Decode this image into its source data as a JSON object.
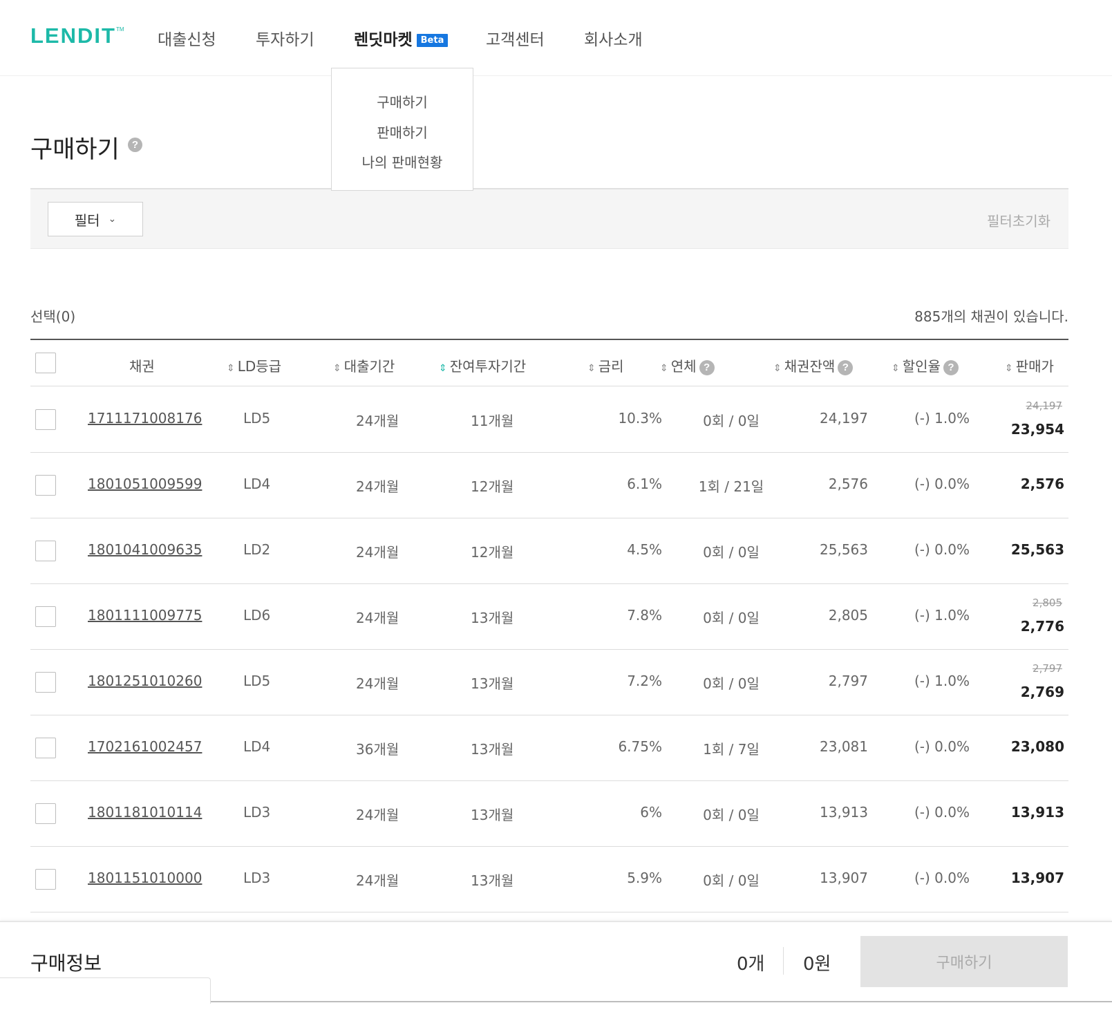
{
  "brand": {
    "logo": "LENDIT",
    "tm": "TM",
    "accent": "#1db9a8"
  },
  "nav": {
    "items": [
      {
        "label": "대출신청"
      },
      {
        "label": "투자하기"
      },
      {
        "label": "렌딧마켓",
        "badge": "Beta"
      },
      {
        "label": "고객센터"
      },
      {
        "label": "회사소개"
      }
    ],
    "dropdown": [
      "구매하기",
      "판매하기",
      "나의 판매현황"
    ]
  },
  "page": {
    "title": "구매하기",
    "help": "?"
  },
  "filter": {
    "button_label": "필터",
    "reset_label": "필터초기화"
  },
  "summary": {
    "selected": "선택(0)",
    "total": "885개의 채권이 있습니다."
  },
  "table": {
    "headers": {
      "bond": "채권",
      "grade": "LD등급",
      "term": "대출기간",
      "remain": "잔여투자기간",
      "rate": "금리",
      "overdue": "연체",
      "balance": "채권잔액",
      "discount": "할인율",
      "price": "판매가"
    },
    "rows": [
      {
        "bond": "1711171008176",
        "grade": "LD5",
        "term": "24개월",
        "remain": "11개월",
        "rate": "10.3%",
        "overdue": "0회 / 0일",
        "balance": "24,197",
        "discount": "(-) 1.0%",
        "orig_price": "24,197",
        "price": "23,954"
      },
      {
        "bond": "1801051009599",
        "grade": "LD4",
        "term": "24개월",
        "remain": "12개월",
        "rate": "6.1%",
        "overdue": "1회 / 21일",
        "balance": "2,576",
        "discount": "(-) 0.0%",
        "orig_price": "",
        "price": "2,576"
      },
      {
        "bond": "1801041009635",
        "grade": "LD2",
        "term": "24개월",
        "remain": "12개월",
        "rate": "4.5%",
        "overdue": "0회 / 0일",
        "balance": "25,563",
        "discount": "(-) 0.0%",
        "orig_price": "",
        "price": "25,563"
      },
      {
        "bond": "1801111009775",
        "grade": "LD6",
        "term": "24개월",
        "remain": "13개월",
        "rate": "7.8%",
        "overdue": "0회 / 0일",
        "balance": "2,805",
        "discount": "(-) 1.0%",
        "orig_price": "2,805",
        "price": "2,776"
      },
      {
        "bond": "1801251010260",
        "grade": "LD5",
        "term": "24개월",
        "remain": "13개월",
        "rate": "7.2%",
        "overdue": "0회 / 0일",
        "balance": "2,797",
        "discount": "(-) 1.0%",
        "orig_price": "2,797",
        "price": "2,769"
      },
      {
        "bond": "1702161002457",
        "grade": "LD4",
        "term": "36개월",
        "remain": "13개월",
        "rate": "6.75%",
        "overdue": "1회 / 7일",
        "balance": "23,081",
        "discount": "(-) 0.0%",
        "orig_price": "",
        "price": "23,080"
      },
      {
        "bond": "1801181010114",
        "grade": "LD3",
        "term": "24개월",
        "remain": "13개월",
        "rate": "6%",
        "overdue": "0회 / 0일",
        "balance": "13,913",
        "discount": "(-) 0.0%",
        "orig_price": "",
        "price": "13,913"
      },
      {
        "bond": "1801151010000",
        "grade": "LD3",
        "term": "24개월",
        "remain": "13개월",
        "rate": "5.9%",
        "overdue": "0회 / 0일",
        "balance": "13,907",
        "discount": "(-) 0.0%",
        "orig_price": "",
        "price": "13,907"
      }
    ]
  },
  "bottom": {
    "title": "구매정보",
    "count": "0개",
    "amount": "0원",
    "buy_label": "구매하기"
  }
}
